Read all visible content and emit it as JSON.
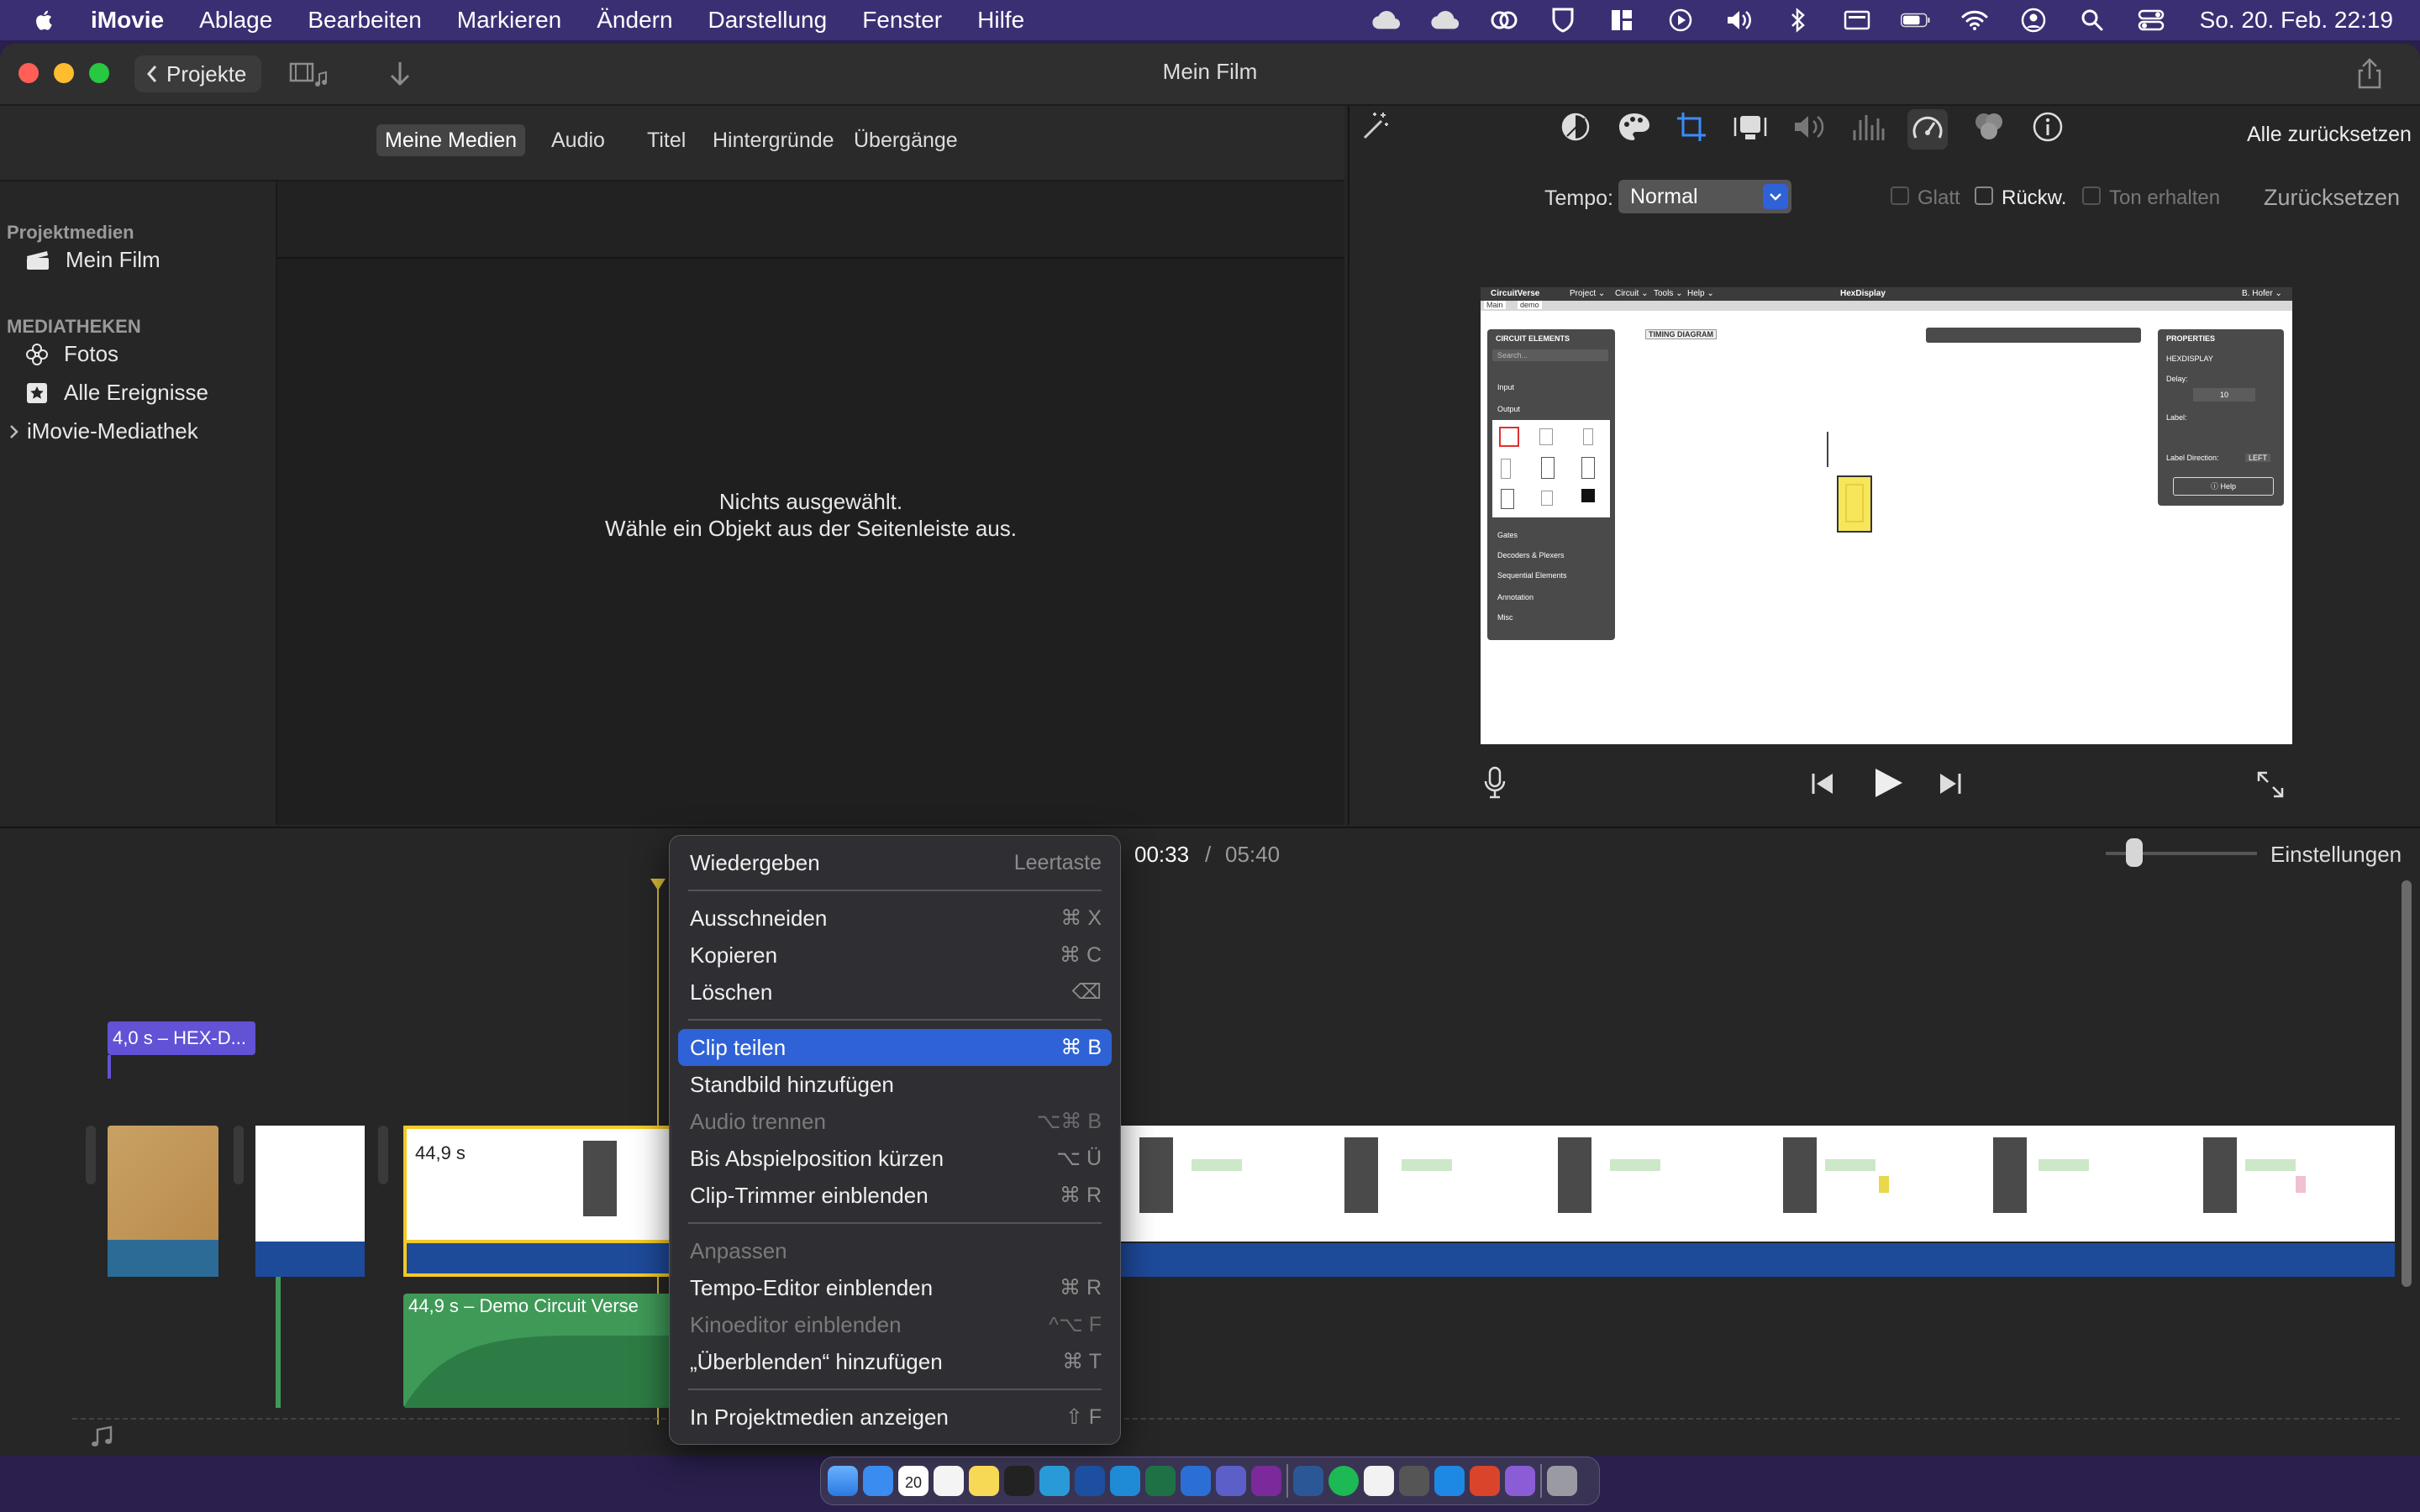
{
  "menubar": {
    "app_name": "iMovie",
    "items": [
      "Ablage",
      "Bearbeiten",
      "Markieren",
      "Ändern",
      "Darstellung",
      "Fenster",
      "Hilfe"
    ],
    "clock": "So. 20. Feb.  22:19"
  },
  "window": {
    "title": "Mein Film",
    "projects_button": "Projekte"
  },
  "browser": {
    "tabs": [
      "Meine Medien",
      "Audio",
      "Titel",
      "Hintergründe",
      "Übergänge"
    ],
    "empty_line1": "Nichts ausgewählt.",
    "empty_line2": "Wähle ein Objekt aus der Seitenleiste aus."
  },
  "sidebar": {
    "section1": "Projektmedien",
    "project_item": "Mein Film",
    "section2": "MEDIATHEKEN",
    "items": [
      "Fotos",
      "Alle Ereignisse",
      "iMovie-Mediathek"
    ]
  },
  "viewer": {
    "reset_all": "Alle zurücksetzen",
    "speed_label": "Tempo:",
    "speed_value": "Normal",
    "smooth_label": "Glatt",
    "reverse_label": "Rückw.",
    "preserve_label": "Ton erhalten",
    "reset": "Zurücksetzen"
  },
  "preview": {
    "app_name": "CircuitVerse",
    "menus": [
      "Project ⌄",
      "Circuit ⌄",
      "Tools ⌄",
      "Help ⌄"
    ],
    "doc_title": "HexDisplay",
    "user": "B. Hofer ⌄",
    "tabs": [
      "Main",
      "demo"
    ],
    "panel_title": "CIRCUIT ELEMENTS",
    "search_placeholder": "Search...",
    "categories": [
      "Input",
      "Output",
      "Gates",
      "Decoders & Plexers",
      "Sequential Elements",
      "Annotation",
      "Misc"
    ],
    "timing": "TIMING DIAGRAM",
    "props_title": "PROPERTIES",
    "props_element": "HEXDISPLAY",
    "delay_label": "Delay:",
    "delay_value": "10",
    "label_label": "Label:",
    "label_dir_label": "Label Direction:",
    "label_dir_value": "LEFT",
    "help": "ⓘ Help"
  },
  "timeline": {
    "current_time": "00:33",
    "separator": "/",
    "total_time": "05:40",
    "settings": "Einstellungen",
    "title_clip": "4,0 s – HEX-D...",
    "clip_duration": "44,9 s",
    "audio_clip": "44,9 s – Demo Circuit Verse"
  },
  "context_menu": {
    "items": [
      {
        "label": "Wiedergeben",
        "shortcut": "Leertaste"
      },
      {
        "label": "Ausschneiden",
        "shortcut": "⌘ X"
      },
      {
        "label": "Kopieren",
        "shortcut": "⌘ C"
      },
      {
        "label": "Löschen",
        "shortcut": "⌫"
      },
      {
        "label": "Clip teilen",
        "shortcut": "⌘ B"
      },
      {
        "label": "Standbild hinzufügen",
        "shortcut": ""
      },
      {
        "label": "Audio trennen",
        "shortcut": "⌥⌘ B"
      },
      {
        "label": "Bis Abspielposition kürzen",
        "shortcut": "⌥ Ü"
      },
      {
        "label": "Clip-Trimmer einblenden",
        "shortcut": "⌘ R"
      },
      {
        "label": "Anpassen",
        "shortcut": ""
      },
      {
        "label": "Tempo-Editor einblenden",
        "shortcut": "⌘ R"
      },
      {
        "label": "Kinoeditor einblenden",
        "shortcut": "^⌥ F"
      },
      {
        "label": "„Überblenden“ hinzufügen",
        "shortcut": "⌘ T"
      },
      {
        "label": "In Projektmedien anzeigen",
        "shortcut": "⇧ F"
      }
    ]
  },
  "dock": {
    "calendar_day": "20"
  },
  "colors": {
    "accent": "#2f62d6",
    "menubar": "#3b2f73",
    "filmstrip": "#1e4a9a",
    "audio": "#3f9a58",
    "title_clip": "#6152d6",
    "selection": "#f3c928"
  }
}
